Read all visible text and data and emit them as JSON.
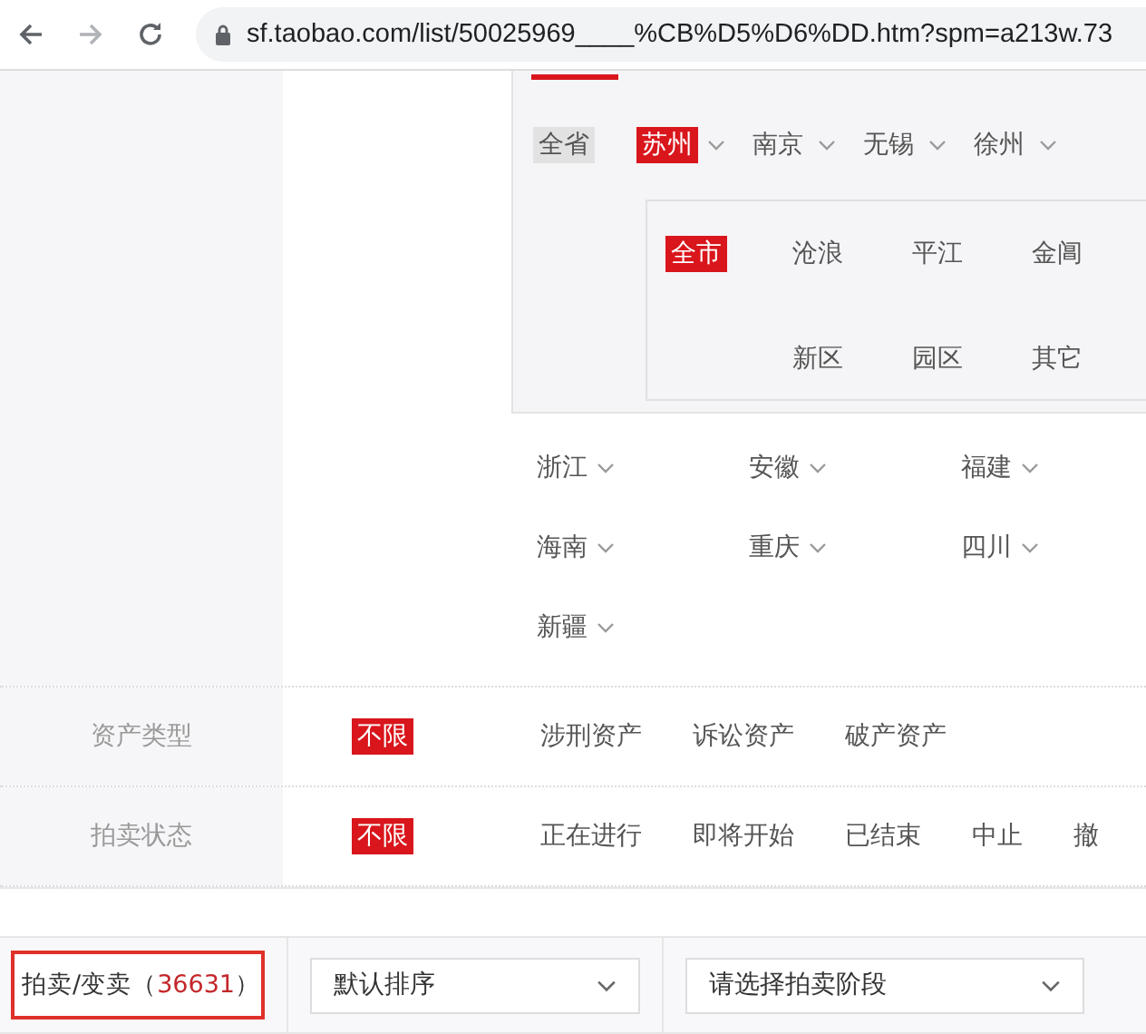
{
  "browser": {
    "url": "sf.taobao.com/list/50025969____%CB%D5%D6%DD.htm?spm=a213w.73"
  },
  "location": {
    "top_row": [
      {
        "label": "全省",
        "kind": "all",
        "selected": false
      },
      {
        "label": "苏州",
        "kind": "city",
        "selected": true
      },
      {
        "label": "南京",
        "kind": "city",
        "selected": false
      },
      {
        "label": "无锡",
        "kind": "city",
        "selected": false
      },
      {
        "label": "徐州",
        "kind": "city",
        "selected": false
      }
    ],
    "districts": [
      {
        "label": "全市",
        "kind": "all",
        "selected": true
      },
      {
        "label": "沧浪",
        "kind": "district",
        "selected": false
      },
      {
        "label": "平江",
        "kind": "district",
        "selected": false
      },
      {
        "label": "金阊",
        "kind": "district",
        "selected": false
      },
      {
        "label": "新区",
        "kind": "district",
        "selected": false
      },
      {
        "label": "园区",
        "kind": "district",
        "selected": false
      },
      {
        "label": "其它",
        "kind": "district",
        "selected": false
      }
    ],
    "provinces": [
      "浙江",
      "安徽",
      "福建",
      "海南",
      "重庆",
      "四川",
      "新疆"
    ]
  },
  "filters": [
    {
      "label": "资产类型",
      "options": [
        {
          "label": "不限",
          "selected": true
        },
        {
          "label": "涉刑资产",
          "selected": false
        },
        {
          "label": "诉讼资产",
          "selected": false
        },
        {
          "label": "破产资产",
          "selected": false
        }
      ]
    },
    {
      "label": "拍卖状态",
      "options": [
        {
          "label": "不限",
          "selected": true
        },
        {
          "label": "正在进行",
          "selected": false
        },
        {
          "label": "即将开始",
          "selected": false
        },
        {
          "label": "已结束",
          "selected": false
        },
        {
          "label": "中止",
          "selected": false
        },
        {
          "label": "撤",
          "selected": false
        }
      ]
    }
  ],
  "toolbar": {
    "tab": {
      "label": "拍卖/变卖（",
      "count": "36631",
      "suffix": "）"
    },
    "sort": {
      "value": "默认排序"
    },
    "stage": {
      "placeholder": "请选择拍卖阶段"
    }
  }
}
